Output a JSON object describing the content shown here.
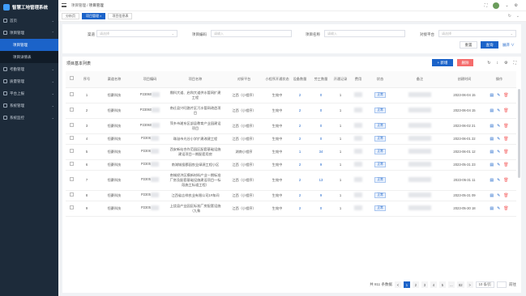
{
  "app": {
    "title": "智慧工地管理系统"
  },
  "sidebar": {
    "items": [
      {
        "label": "首页"
      },
      {
        "label": "项目管理"
      },
      {
        "label": "项目管理",
        "active": true
      },
      {
        "label": "项目详情表"
      },
      {
        "label": "考勤管理"
      },
      {
        "label": "质量管理"
      },
      {
        "label": "平台上报"
      },
      {
        "label": "系统管理"
      },
      {
        "label": "系统监控"
      }
    ]
  },
  "topbar": {
    "breadcrumb_parent": "项目管理",
    "breadcrumb_sep": "/",
    "breadcrumb_current": "项目管理"
  },
  "tabs": [
    {
      "label": "分析页"
    },
    {
      "label": "项目管理 ×"
    },
    {
      "label": "项目信息表"
    }
  ],
  "filters": {
    "channel_label": "渠道",
    "channel_placeholder": "请选择",
    "code_label": "项目编码",
    "code_placeholder": "请输入",
    "name_label": "项目名称",
    "name_placeholder": "请输入",
    "platform_label": "对接平台",
    "platform_placeholder": "请选择",
    "reset": "重置",
    "search": "查询",
    "expand": "展开 ∨"
  },
  "panel": {
    "title": "项目基本列表",
    "add": "+ 新增",
    "delete": "删除"
  },
  "table": {
    "headers": [
      "序号",
      "渠道名称",
      "项目编码",
      "项目名称",
      "对接平台",
      "小程序开通状态",
      "设备数量",
      "劳工数量",
      "开通记录",
      "费用",
      "状态",
      "备注",
      "创建时间",
      "操作"
    ],
    "rows": [
      {
        "idx": "1",
        "channel": "恒豪科技",
        "code": "P23060",
        "name": "鼎科大道、启和大道供水管网扩建工程",
        "platform": "江西（小程序）",
        "mp": "生效中",
        "dev": "2",
        "labor": "0",
        "open": "1",
        "status": "正常",
        "time": "2023-06-04 15"
      },
      {
        "idx": "2",
        "channel": "恒豪科技",
        "code": "P23060",
        "name": "南迁县兴旺路片区污水管网改造项目",
        "platform": "江西（小程序）",
        "mp": "生效中",
        "dev": "2",
        "labor": "0",
        "open": "1",
        "status": "正常",
        "time": "2023-06-04 15"
      },
      {
        "idx": "3",
        "channel": "恒豪科技",
        "code": "P23060",
        "name": "萍乡市湘东区部县教育产业园建设项目",
        "platform": "江西（小程序）",
        "mp": "生效中",
        "dev": "2",
        "labor": "0",
        "open": "1",
        "status": "正常",
        "time": "2023-06-02 21"
      },
      {
        "idx": "4",
        "channel": "恒豪科技",
        "code": "P2306",
        "name": "珠溢市光谷小学扩建改建工程",
        "platform": "江西（小程序）",
        "mp": "生效中",
        "dev": "2",
        "labor": "0",
        "open": "1",
        "status": "正常",
        "time": "2023-06-01 22"
      },
      {
        "idx": "5",
        "channel": "恒豪科技",
        "code": "P2306",
        "name": "西安新站合作范园区配套基础设施建设项目一期配套用房",
        "platform": "湖南小程序",
        "mp": "生效中",
        "dev": "1",
        "labor": "34",
        "open": "1",
        "status": "正常",
        "time": "2023-06-01 12"
      },
      {
        "idx": "6",
        "channel": "恒豪科技",
        "code": "P2305",
        "name": "南湖城投郡园农业绿源工程小区",
        "platform": "江西（小程序）",
        "mp": "生效中",
        "dev": "2",
        "labor": "9",
        "open": "1",
        "status": "正常",
        "time": "2023-05-31 23"
      },
      {
        "idx": "7",
        "channel": "恒豪科技",
        "code": "P2305",
        "name": "南城经济区模新材料产业一期标准厂房及配套基础设施建设项目一标段施工标道工程）",
        "platform": "江西（小程序）",
        "mp": "生效中",
        "dev": "2",
        "labor": "13",
        "open": "1",
        "status": "正常",
        "time": "2023-05-31 11"
      },
      {
        "idx": "8",
        "channel": "恒豪科技",
        "code": "P2305",
        "name": "江西省吉祥农业有限公司1#车间",
        "platform": "江西（小程序）",
        "mp": "生效中",
        "dev": "2",
        "labor": "9",
        "open": "1",
        "status": "正常",
        "time": "2023-05-31 09"
      },
      {
        "idx": "9",
        "channel": "恒豪科技",
        "code": "P2305",
        "name": "上饶县产业园区标准厂房配套设施（九象",
        "platform": "江西（小程序）",
        "mp": "生效中",
        "dev": "2",
        "labor": "0",
        "open": "1",
        "status": "正常",
        "time": "2023-05-30 18"
      }
    ]
  },
  "pager": {
    "total": "共 811 条数据",
    "pages": [
      "1",
      "2",
      "3",
      "4",
      "5",
      "...",
      "82"
    ],
    "prev": "<",
    "next": ">",
    "size": "10 条/页",
    "goto": "前往"
  }
}
